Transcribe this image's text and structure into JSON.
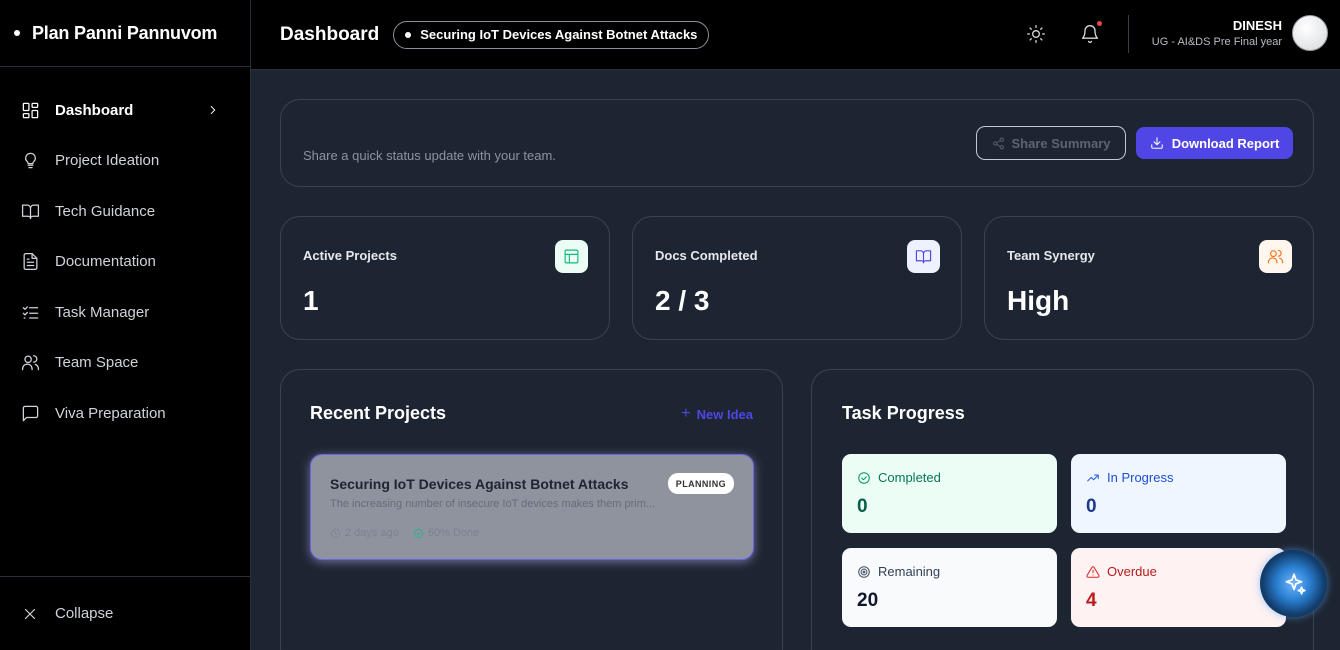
{
  "brand": {
    "name": "Plan Panni Pannuvom"
  },
  "sidebar": {
    "items": [
      {
        "label": "Dashboard",
        "icon": "dashboard-grid-icon",
        "active": true
      },
      {
        "label": "Project Ideation",
        "icon": "lightbulb-icon"
      },
      {
        "label": "Tech Guidance",
        "icon": "book-open-icon"
      },
      {
        "label": "Documentation",
        "icon": "document-icon"
      },
      {
        "label": "Task Manager",
        "icon": "checklist-icon"
      },
      {
        "label": "Team Space",
        "icon": "users-icon"
      },
      {
        "label": "Viva Preparation",
        "icon": "message-square-icon"
      }
    ],
    "collapse_label": "Collapse"
  },
  "header": {
    "title": "Dashboard",
    "project": "Securing IoT Devices Against Botnet Attacks",
    "user_name": "DINESH",
    "user_role": "UG - AI&DS Pre Final year"
  },
  "status": {
    "text": "Share a quick status update with your team.",
    "share_label": "Share Summary",
    "download_label": "Download Report"
  },
  "stats": [
    {
      "label": "Active Projects",
      "value": "1",
      "icon": "layout-icon",
      "color": "#10b981"
    },
    {
      "label": "Docs Completed",
      "value": "2 / 3",
      "icon": "book-open-icon",
      "color": "#4f46e5"
    },
    {
      "label": "Team Synergy",
      "value": "High",
      "icon": "users-icon",
      "color": "#f97316"
    }
  ],
  "recent": {
    "title": "Recent Projects",
    "new_idea_label": "New Idea",
    "project": {
      "title": "Securing IoT Devices Against Botnet Attacks",
      "description": "The increasing number of insecure IoT devices makes them prim...",
      "badge": "PLANNING",
      "time": "2 days ago",
      "progress_text": "60% Done",
      "progress": 60
    }
  },
  "tasks": {
    "title": "Task Progress",
    "items": [
      {
        "label": "Completed",
        "value": "0",
        "icon": "check-circle-icon",
        "color": "#047857"
      },
      {
        "label": "In Progress",
        "value": "0",
        "icon": "trending-up-icon",
        "color": "#1d4ed8"
      },
      {
        "label": "Remaining",
        "value": "20",
        "icon": "target-icon",
        "color": "#334155"
      },
      {
        "label": "Overdue",
        "value": "4",
        "icon": "alert-triangle-icon",
        "color": "#b91c1c"
      }
    ]
  },
  "colors": {
    "accent": "#4f46e5",
    "sidebar_bg": "#000000",
    "main_bg": "#1e2532"
  }
}
